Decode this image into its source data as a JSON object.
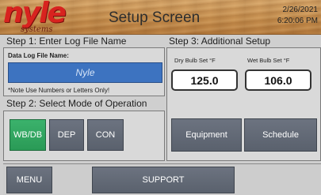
{
  "header": {
    "logo_main": "nyle",
    "logo_sub": "systems",
    "title": "Setup Screen",
    "date": "2/26/2021",
    "time": "6:20:06 PM"
  },
  "step1": {
    "label": "Step 1:  Enter Log File Name",
    "field_caption": "Data Log File Name:",
    "field_value": "Nyle",
    "note": "*Note Use Numbers or Letters Only!"
  },
  "step2": {
    "label": "Step 2:  Select Mode of Operation",
    "modes": [
      {
        "label": "WB/DB",
        "active": true
      },
      {
        "label": "DEP",
        "active": false
      },
      {
        "label": "CON",
        "active": false
      }
    ]
  },
  "step3": {
    "label": "Step 3:  Additional Setup",
    "dry_bulb_caption": "Dry Bulb Set °F",
    "dry_bulb_value": "125.0",
    "wet_bulb_caption": "Wet Bulb Set °F",
    "wet_bulb_value": "106.0",
    "equipment_label": "Equipment",
    "schedule_label": "Schedule"
  },
  "footer": {
    "menu_label": "MENU",
    "support_label": "SUPPORT"
  },
  "colors": {
    "accent_green": "#2a9a56",
    "button_gray": "#5f6672",
    "field_blue": "#3d73c0",
    "logo_red": "#d8231f"
  }
}
